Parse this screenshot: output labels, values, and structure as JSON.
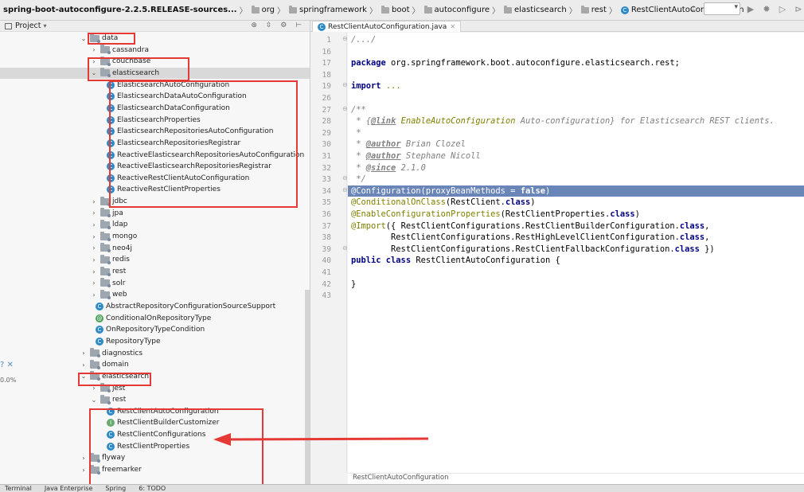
{
  "breadcrumb": {
    "items": [
      {
        "label": "spring-boot-autoconfigure-2.2.5.RELEASE-sources...",
        "icon": "none"
      },
      {
        "label": "org",
        "icon": "folder-icon"
      },
      {
        "label": "springframework",
        "icon": "folder-icon"
      },
      {
        "label": "boot",
        "icon": "folder-icon"
      },
      {
        "label": "autoconfigure",
        "icon": "folder-icon"
      },
      {
        "label": "elasticsearch",
        "icon": "folder-icon"
      },
      {
        "label": "rest",
        "icon": "folder-icon"
      },
      {
        "label": "RestClientAutoConfiguration",
        "icon": "class-icon"
      }
    ]
  },
  "project": {
    "title": "Project",
    "tree": [
      {
        "label": "data",
        "kind": "folder",
        "depth": 0,
        "arrow": "open"
      },
      {
        "label": "cassandra",
        "kind": "folder",
        "depth": 1,
        "arrow": "closed"
      },
      {
        "label": "couchbase",
        "kind": "folder",
        "depth": 1,
        "arrow": "closed"
      },
      {
        "label": "elasticsearch",
        "kind": "folder",
        "depth": 1,
        "arrow": "open",
        "selected": true
      },
      {
        "label": "ElasticsearchAutoConfiguration",
        "kind": "class",
        "depth": 2
      },
      {
        "label": "ElasticsearchDataAutoConfiguration",
        "kind": "class",
        "depth": 2
      },
      {
        "label": "ElasticsearchDataConfiguration",
        "kind": "class",
        "depth": 2
      },
      {
        "label": "ElasticsearchProperties",
        "kind": "class",
        "depth": 2
      },
      {
        "label": "ElasticsearchRepositoriesAutoConfiguration",
        "kind": "class",
        "depth": 2
      },
      {
        "label": "ElasticsearchRepositoriesRegistrar",
        "kind": "class",
        "depth": 2
      },
      {
        "label": "ReactiveElasticsearchRepositoriesAutoConfiguration",
        "kind": "class",
        "depth": 2
      },
      {
        "label": "ReactiveElasticsearchRepositoriesRegistrar",
        "kind": "class",
        "depth": 2
      },
      {
        "label": "ReactiveRestClientAutoConfiguration",
        "kind": "class",
        "depth": 2
      },
      {
        "label": "ReactiveRestClientProperties",
        "kind": "class",
        "depth": 2
      },
      {
        "label": "jdbc",
        "kind": "folder",
        "depth": 1,
        "arrow": "closed"
      },
      {
        "label": "jpa",
        "kind": "folder",
        "depth": 1,
        "arrow": "closed"
      },
      {
        "label": "ldap",
        "kind": "folder",
        "depth": 1,
        "arrow": "closed"
      },
      {
        "label": "mongo",
        "kind": "folder",
        "depth": 1,
        "arrow": "closed"
      },
      {
        "label": "neo4j",
        "kind": "folder",
        "depth": 1,
        "arrow": "closed"
      },
      {
        "label": "redis",
        "kind": "folder",
        "depth": 1,
        "arrow": "closed"
      },
      {
        "label": "rest",
        "kind": "folder",
        "depth": 1,
        "arrow": "closed"
      },
      {
        "label": "solr",
        "kind": "folder",
        "depth": 1,
        "arrow": "closed"
      },
      {
        "label": "web",
        "kind": "folder",
        "depth": 1,
        "arrow": "closed"
      },
      {
        "label": "AbstractRepositoryConfigurationSourceSupport",
        "kind": "class",
        "depth": 1
      },
      {
        "label": "ConditionalOnRepositoryType",
        "kind": "annotation",
        "depth": 1
      },
      {
        "label": "OnRepositoryTypeCondition",
        "kind": "class",
        "depth": 1
      },
      {
        "label": "RepositoryType",
        "kind": "class",
        "depth": 1
      },
      {
        "label": "diagnostics",
        "kind": "folder",
        "depth": 0,
        "arrow": "closed"
      },
      {
        "label": "domain",
        "kind": "folder",
        "depth": 0,
        "arrow": "closed"
      },
      {
        "label": "elasticsearch",
        "kind": "folder",
        "depth": 0,
        "arrow": "open"
      },
      {
        "label": "jest",
        "kind": "folder",
        "depth": 1,
        "arrow": "closed"
      },
      {
        "label": "rest",
        "kind": "folder",
        "depth": 1,
        "arrow": "open"
      },
      {
        "label": "RestClientAutoConfiguration",
        "kind": "class",
        "depth": 2
      },
      {
        "label": "RestClientBuilderCustomizer",
        "kind": "interface",
        "depth": 2
      },
      {
        "label": "RestClientConfigurations",
        "kind": "class",
        "depth": 2
      },
      {
        "label": "RestClientProperties",
        "kind": "class",
        "depth": 2
      },
      {
        "label": "flyway",
        "kind": "folder",
        "depth": 0,
        "arrow": "closed"
      },
      {
        "label": "freemarker",
        "kind": "folder",
        "depth": 0,
        "arrow": "closed"
      }
    ]
  },
  "left_strip": {
    "percent": "0.0%"
  },
  "editor": {
    "tab_label": "RestClientAutoConfiguration.java",
    "status_label": "RestClientAutoConfiguration",
    "lines": [
      {
        "n": "1",
        "html": "<span class='cm'>/.../</span>"
      },
      {
        "n": "16",
        "html": ""
      },
      {
        "n": "17",
        "html": "<span class='kw'>package</span> org.springframework.boot.autoconfigure.elasticsearch.rest;"
      },
      {
        "n": "18",
        "html": ""
      },
      {
        "n": "19",
        "html": "<span class='kw'>import</span> <span class='cm' style='font-style:normal;color:#808000'>...</span>"
      },
      {
        "n": "26",
        "html": ""
      },
      {
        "n": "27",
        "html": "<span class='cm'>/**</span>"
      },
      {
        "n": "28",
        "html": "<span class='cm'> * {</span><span class='tag'>@link</span><span class='lnk'> EnableAutoConfiguration</span><span class='cm'> Auto-configuration} for Elasticsearch REST clients.</span>"
      },
      {
        "n": "29",
        "html": "<span class='cm'> *</span>"
      },
      {
        "n": "30",
        "html": "<span class='cm'> * </span><span class='tag'>@author</span><span class='cm'> Brian Clozel</span>"
      },
      {
        "n": "31",
        "html": "<span class='cm'> * </span><span class='tag'>@author</span><span class='cm'> Stephane Nicoll</span>"
      },
      {
        "n": "32",
        "html": "<span class='cm'> * </span><span class='tag'>@since</span><span class='cm'> 2.1.0</span>"
      },
      {
        "n": "33",
        "html": "<span class='cm'> */</span>"
      },
      {
        "n": "34",
        "html": "@Configuration(proxyBeanMethods = <b>false</b>)",
        "highlight": true
      },
      {
        "n": "35",
        "html": "<span class='ann'>@ConditionalOnClass</span>(RestClient.<span class='kw'>class</span>)"
      },
      {
        "n": "36",
        "html": "<span class='ann'>@EnableConfigurationProperties</span>(RestClientProperties.<span class='kw'>class</span>)"
      },
      {
        "n": "37",
        "html": "<span class='ann'>@Import</span>({ RestClientConfigurations.RestClientBuilderConfiguration.<span class='kw'>class</span>,"
      },
      {
        "n": "38",
        "html": "        RestClientConfigurations.RestHighLevelClientConfiguration.<span class='kw'>class</span>,"
      },
      {
        "n": "39",
        "html": "        RestClientConfigurations.RestClientFallbackConfiguration.<span class='kw'>class</span> })"
      },
      {
        "n": "40",
        "html": "<span class='kw'>public class</span> RestClientAutoConfiguration {"
      },
      {
        "n": "41",
        "html": ""
      },
      {
        "n": "42",
        "html": "}"
      },
      {
        "n": "43",
        "html": ""
      }
    ]
  },
  "bottom": {
    "items": [
      "Terminal",
      "Java Enterprise",
      "Spring",
      "6: TODO"
    ]
  },
  "colors": {
    "highlight_box": "#e53935",
    "selection_line": "#6a85b8",
    "class_icon": "#2d8ac7"
  }
}
